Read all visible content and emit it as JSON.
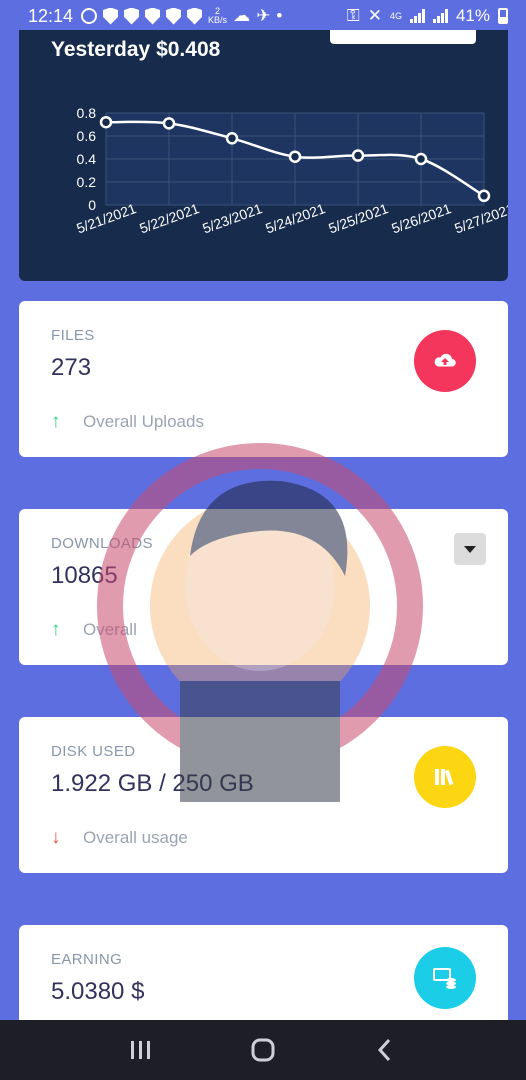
{
  "status_bar": {
    "time": "12:14",
    "speed_value": "2",
    "speed_unit": "KB/s",
    "network": "4G",
    "battery": "41%"
  },
  "chart": {
    "title": "Yesterday $0.408"
  },
  "chart_data": {
    "type": "line",
    "title": "Yesterday $0.408",
    "categories": [
      "5/21/2021",
      "5/22/2021",
      "5/23/2021",
      "5/24/2021",
      "5/25/2021",
      "5/26/2021",
      "5/27/2021"
    ],
    "series": [
      {
        "values": [
          0.72,
          0.71,
          0.58,
          0.42,
          0.43,
          0.4,
          0.08
        ]
      }
    ],
    "ylim": [
      0,
      0.8
    ],
    "yticks": [
      "0",
      "0.2",
      "0.4",
      "0.6",
      "0.8"
    ],
    "grid": true,
    "line_color": "#ffffff"
  },
  "cards": {
    "files": {
      "label": "FILES",
      "value": "273",
      "footer": "Overall Uploads",
      "icon": "cloud-upload-icon",
      "color": "#f5365c"
    },
    "downloads": {
      "label": "DOWNLOADS",
      "value": "10865",
      "footer": "Overall",
      "icon": "dropdown-icon"
    },
    "disk": {
      "label": "DISK USED",
      "value": "1.922 GB / 250 GB",
      "footer": "Overall usage",
      "icon": "books-icon",
      "color": "#fcd612"
    },
    "earning": {
      "label": "EARNING",
      "value": "5.0380 $",
      "icon": "money-icon",
      "color": "#1ccde8"
    }
  },
  "nav": {
    "recent": "recent-apps-icon",
    "home": "home-icon",
    "back": "back-icon"
  }
}
